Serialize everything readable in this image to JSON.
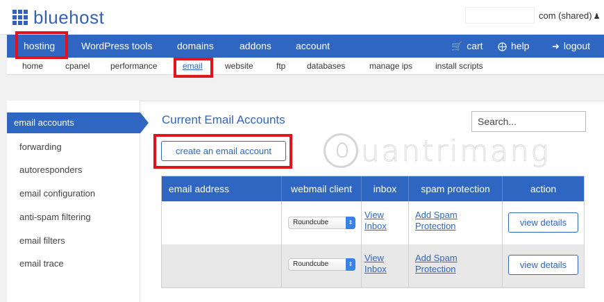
{
  "header": {
    "logo_text": "bluehost",
    "account_text": "com (shared)",
    "user_icon": "user-icon"
  },
  "mainnav": {
    "items": [
      {
        "label": "hosting"
      },
      {
        "label": "WordPress tools"
      },
      {
        "label": "domains"
      },
      {
        "label": "addons"
      },
      {
        "label": "account"
      }
    ],
    "cart_label": "cart",
    "help_label": "help",
    "logout_label": "logout"
  },
  "subnav": {
    "items": [
      {
        "label": "home"
      },
      {
        "label": "cpanel"
      },
      {
        "label": "performance"
      },
      {
        "label": "email"
      },
      {
        "label": "website"
      },
      {
        "label": "ftp"
      },
      {
        "label": "databases"
      },
      {
        "label": "manage ips"
      },
      {
        "label": "install scripts"
      }
    ]
  },
  "sidebar": {
    "items": [
      {
        "label": "email accounts"
      },
      {
        "label": "forwarding"
      },
      {
        "label": "autoresponders"
      },
      {
        "label": "email configuration"
      },
      {
        "label": "anti-spam filtering"
      },
      {
        "label": "email filters"
      },
      {
        "label": "email trace"
      }
    ]
  },
  "main": {
    "title": "Current Email Accounts",
    "search_placeholder": "Search...",
    "create_button": "create an email account",
    "watermark": "uantrimang"
  },
  "table": {
    "headers": [
      "email address",
      "webmail client",
      "inbox",
      "spam protection",
      "action"
    ],
    "rows": [
      {
        "email": "",
        "webmail": "Roundcube",
        "inbox_line1": "View",
        "inbox_line2": "Inbox",
        "spam_line1": "Add Spam",
        "spam_line2": "Protection",
        "action": "view details"
      },
      {
        "email": "",
        "webmail": "Roundcube",
        "inbox_line1": "View",
        "inbox_line2": "Inbox",
        "spam_line1": "Add Spam",
        "spam_line2": "Protection",
        "action": "view details"
      }
    ]
  },
  "colors": {
    "brand_blue": "#2e66c1",
    "highlight_red": "#e3131b"
  }
}
